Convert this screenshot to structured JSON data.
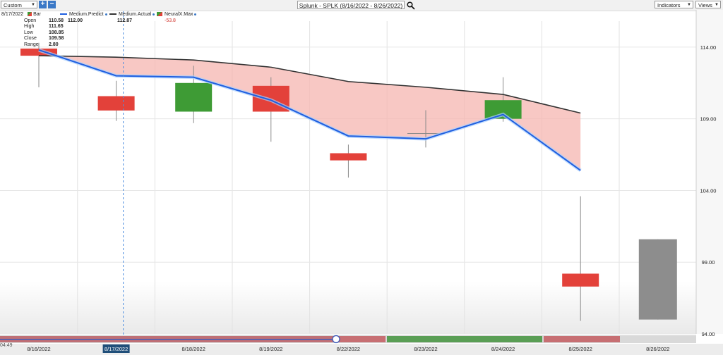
{
  "toolbar": {
    "range_select": "Custom",
    "add_label": "+",
    "remove_label": "−",
    "chart_title": "Splunk - SPLK (8/16/2022 - 8/26/2022)",
    "indicators_label": "Indicators",
    "views_label": "Views"
  },
  "legend": {
    "date": "8/17/2022",
    "bar_label": "Bar",
    "predict_label": "Medium.Predict",
    "predict_value": "112.00",
    "actual_label": "Medium.Actual",
    "actual_value": "112.87",
    "neuralx_label": "NeuralX.Max",
    "neuralx_value": "-53.8"
  },
  "ohlc": {
    "open_label": "Open",
    "open": "110.58",
    "high_label": "High",
    "high": "111.65",
    "low_label": "Low",
    "low": "108.85",
    "close_label": "Close",
    "close": "109.58",
    "range_label": "Range",
    "range": "2.80"
  },
  "time_stub": "04:49",
  "colors": {
    "up": "#3e9b35",
    "down": "#e3413a",
    "predict": "#1f5fe0",
    "actual": "#333333",
    "fill": "#f5b6b0",
    "projection": "#8d8d8d"
  },
  "chart_data": {
    "type": "candlestick",
    "categories": [
      "8/16/2022",
      "8/17/2022",
      "8/18/2022",
      "8/19/2022",
      "8/22/2022",
      "8/23/2022",
      "8/24/2022",
      "8/25/2022",
      "8/26/2022"
    ],
    "yticks": [
      "114.00",
      "109.00",
      "104.00",
      "99.00",
      "94.00"
    ],
    "ylim": [
      94,
      116.5
    ],
    "selected": "8/17/2022",
    "candles": [
      {
        "date": "8/16/2022",
        "open": 113.9,
        "high": 114.3,
        "low": 111.2,
        "close": 113.4,
        "color": "down"
      },
      {
        "date": "8/17/2022",
        "open": 110.58,
        "high": 111.65,
        "low": 108.85,
        "close": 109.58,
        "color": "down"
      },
      {
        "date": "8/18/2022",
        "open": 109.5,
        "high": 112.7,
        "low": 108.7,
        "close": 111.5,
        "color": "up"
      },
      {
        "date": "8/19/2022",
        "open": 111.3,
        "high": 111.9,
        "low": 107.4,
        "close": 109.5,
        "color": "down"
      },
      {
        "date": "8/22/2022",
        "open": 106.6,
        "high": 107.2,
        "low": 104.9,
        "close": 106.1,
        "color": "down"
      },
      {
        "date": "8/23/2022",
        "open": 108.0,
        "high": 109.6,
        "low": 107.0,
        "close": 108.0,
        "color": "flat"
      },
      {
        "date": "8/24/2022",
        "open": 109.0,
        "high": 111.9,
        "low": 108.8,
        "close": 110.3,
        "color": "up"
      },
      {
        "date": "8/25/2022",
        "open": 98.2,
        "high": 103.6,
        "low": 94.9,
        "close": 97.3,
        "color": "down"
      },
      {
        "date": "8/26/2022",
        "open": 95.0,
        "high": 100.6,
        "low": 95.0,
        "close": 100.6,
        "color": "projection"
      }
    ],
    "series": [
      {
        "name": "Medium.Predict",
        "values": [
          113.8,
          112.0,
          111.9,
          110.3,
          107.8,
          107.6,
          109.3,
          105.4,
          null
        ]
      },
      {
        "name": "Medium.Actual",
        "values": [
          113.4,
          113.3,
          113.1,
          112.6,
          111.6,
          111.2,
          110.7,
          109.4,
          null
        ]
      }
    ]
  }
}
